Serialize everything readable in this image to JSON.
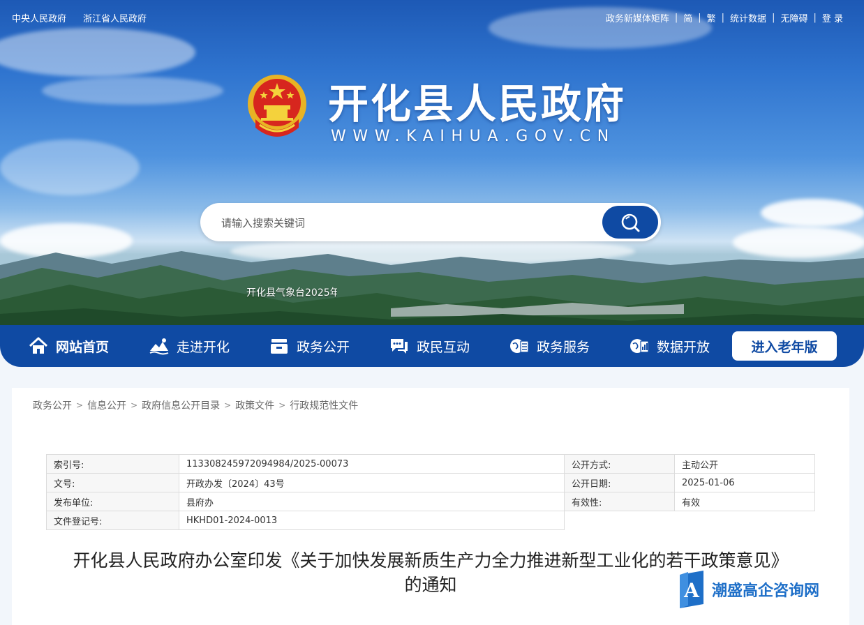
{
  "header": {
    "top_left_links": [
      "中央人民政府",
      "浙江省人民政府"
    ],
    "top_right_links": [
      "政务新媒体矩阵",
      "简",
      "繁",
      "统计数据",
      "无障碍",
      "登 录"
    ],
    "separator": "|",
    "site_title": "开化县人民政府",
    "site_domain": "WWW.KAIHUA.GOV.CN",
    "emblem_icon": "national-emblem-icon",
    "search": {
      "placeholder": "请输入搜索关键词",
      "icon": "search-icon"
    },
    "ticker_text": "开化县气象台2025年"
  },
  "nav": {
    "items": [
      {
        "label": "网站首页",
        "icon": "home-icon"
      },
      {
        "label": "走进开化",
        "icon": "landscape-icon"
      },
      {
        "label": "政务公开",
        "icon": "inbox-icon"
      },
      {
        "label": "政民互动",
        "icon": "chat-icon"
      },
      {
        "label": "政务服务",
        "icon": "globe-doc-icon"
      },
      {
        "label": "数据开放",
        "icon": "globe-data-icon"
      }
    ],
    "elder_button": "进入老年版"
  },
  "breadcrumb": [
    "政务公开",
    "信息公开",
    "政府信息公开目录",
    "政策文件",
    "行政规范性文件"
  ],
  "breadcrumb_sep": ">",
  "meta": {
    "rows": [
      [
        "索引号:",
        "113308245972094984/2025-00073",
        "公开方式:",
        "主动公开"
      ],
      [
        "文号:",
        "开政办发〔2024〕43号",
        "公开日期:",
        "2025-01-06"
      ],
      [
        "发布单位:",
        "县府办",
        "有效性:",
        "有效"
      ],
      [
        "文件登记号:",
        "HKHD01-2024-0013"
      ]
    ]
  },
  "document": {
    "title_line1": "开化县人民政府办公室印发《关于加快发展新质生产力全力推进新型工业化的若干政策意见》",
    "title_line2": "的通知"
  },
  "watermark": {
    "text": "潮盛高企咨询网",
    "icon_letter": "A"
  },
  "colors": {
    "nav_blue": "#0f4aa3",
    "watermark_blue": "#1e6fc8"
  }
}
